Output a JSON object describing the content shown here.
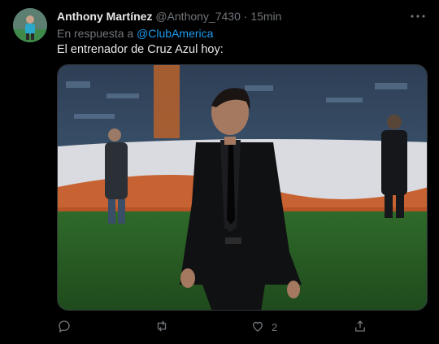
{
  "tweet": {
    "author_name": "Anthony Martínez",
    "handle": "@Anthony_7430",
    "separator": "·",
    "time": "15min",
    "reply_prefix": "En respuesta a",
    "reply_to": "@ClubAmerica",
    "text": "El entrenador de Cruz Azul hoy:",
    "likes": "2"
  },
  "icons": [
    "more-icon",
    "reply-icon",
    "retweet-icon",
    "like-icon",
    "share-icon"
  ],
  "colors": {
    "background": "#000000",
    "text": "#e7e9ea",
    "muted": "#71767b",
    "link": "#1d9bf0"
  }
}
